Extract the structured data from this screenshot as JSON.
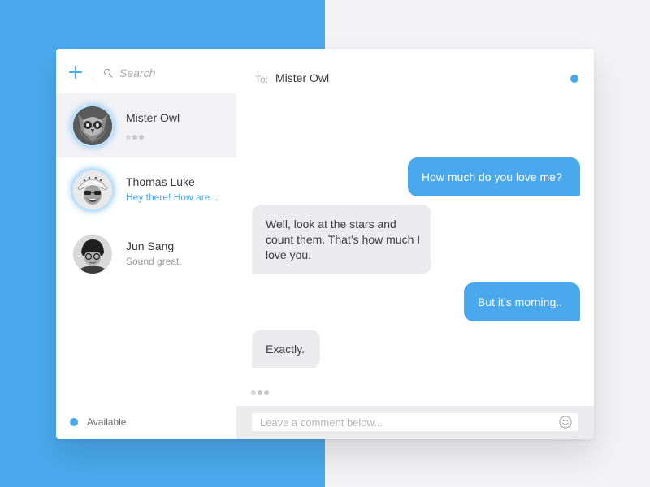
{
  "colors": {
    "accent": "#4aa9ed",
    "bubble_in": "#ececef",
    "sidebar_active": "#f3f3f6"
  },
  "sidebar": {
    "add_icon": "plus-icon",
    "search": {
      "icon": "search-icon",
      "placeholder": "Search",
      "value": ""
    },
    "contacts": [
      {
        "name": "Mister Owl",
        "subtitle": "",
        "typing": true,
        "active": true,
        "online": true
      },
      {
        "name": "Thomas Luke",
        "subtitle": "Hey there! How are...",
        "typing": false,
        "active": false,
        "online": true
      },
      {
        "name": "Jun Sang",
        "subtitle": "Sound great.",
        "typing": false,
        "active": false,
        "online": false
      }
    ],
    "status": {
      "label": "Available"
    }
  },
  "conversation": {
    "to_label": "To:",
    "recipient": "Mister Owl",
    "messages": [
      {
        "direction": "outgoing",
        "text": "How much do you love me?"
      },
      {
        "direction": "incoming",
        "text": "Well, look at the stars and count them. That’s how much I love you."
      },
      {
        "direction": "outgoing",
        "text": "But it’s morning.."
      },
      {
        "direction": "incoming",
        "text": "Exactly."
      }
    ],
    "typing": true,
    "composer": {
      "placeholder": "Leave a comment below...",
      "value": "",
      "emoji_icon": "smiley-icon"
    }
  }
}
